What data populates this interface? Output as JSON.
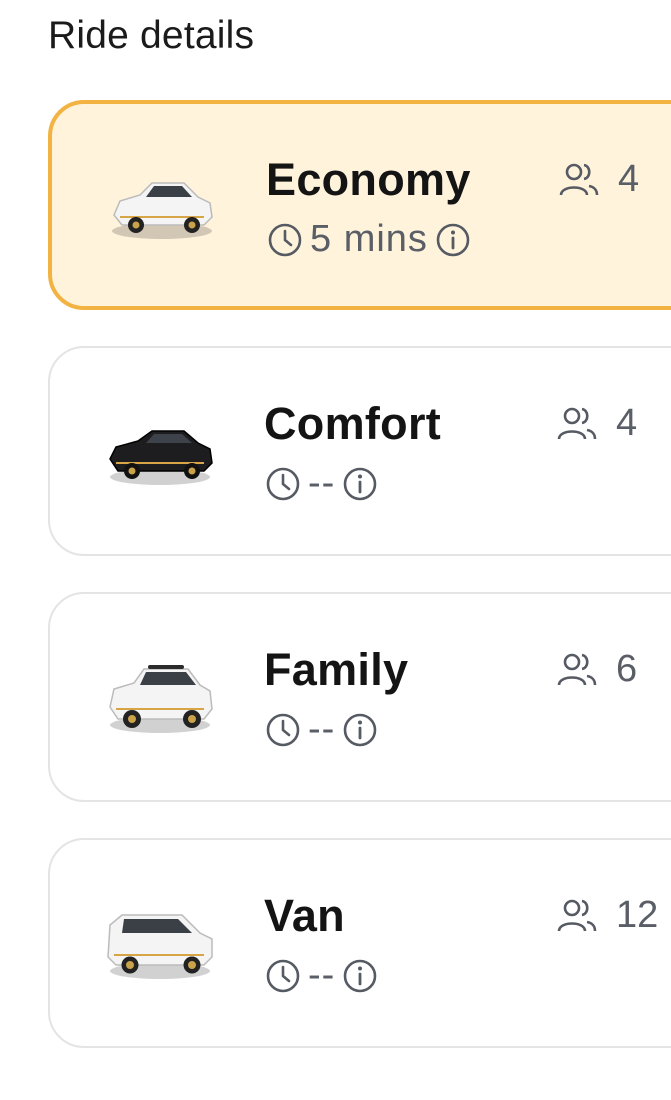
{
  "section": {
    "title": "Ride details"
  },
  "rides": [
    {
      "name": "Economy",
      "eta": "5 mins",
      "seats": "4",
      "selected": true,
      "car": "sedan-white",
      "icon": "car-icon"
    },
    {
      "name": "Comfort",
      "eta": "--",
      "seats": "4",
      "selected": false,
      "car": "sedan-black",
      "icon": "car-icon"
    },
    {
      "name": "Family",
      "eta": "--",
      "seats": "6",
      "selected": false,
      "car": "suv-white",
      "icon": "suv-icon"
    },
    {
      "name": "Van",
      "eta": "--",
      "seats": "12",
      "selected": false,
      "car": "van-white",
      "icon": "van-icon"
    }
  ],
  "icons": {
    "clock": "clock-icon",
    "info": "info-icon",
    "passengers": "passengers-icon"
  },
  "colors": {
    "selected_bg": "#fff3dc",
    "selected_border": "#f2b342",
    "card_border": "#e4e4e4",
    "muted_text": "#5a5e66"
  }
}
